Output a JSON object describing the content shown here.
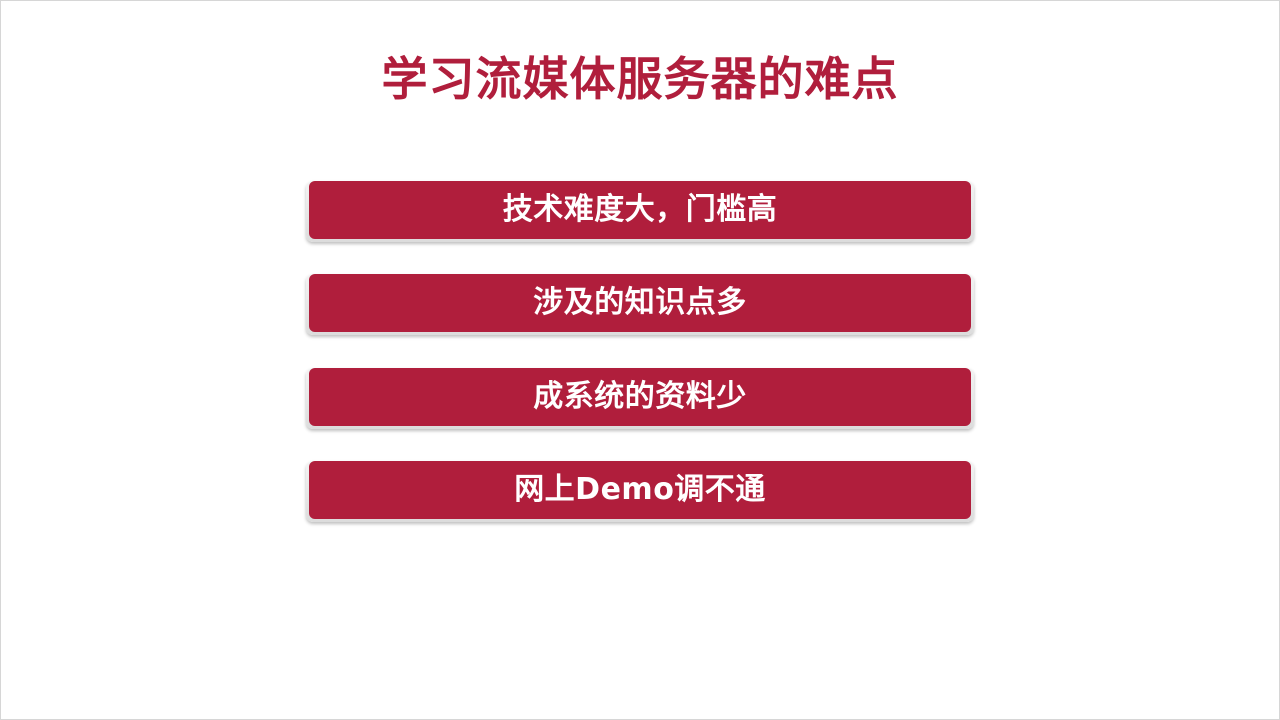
{
  "slide": {
    "title": "学习流媒体服务器的难点",
    "points": [
      "技术难度大，门槛高",
      "涉及的知识点多",
      "成系统的资料少",
      "网上Demo调不通"
    ]
  },
  "colors": {
    "accent": "#b01e3c",
    "background": "#ffffff",
    "text_on_accent": "#ffffff"
  }
}
